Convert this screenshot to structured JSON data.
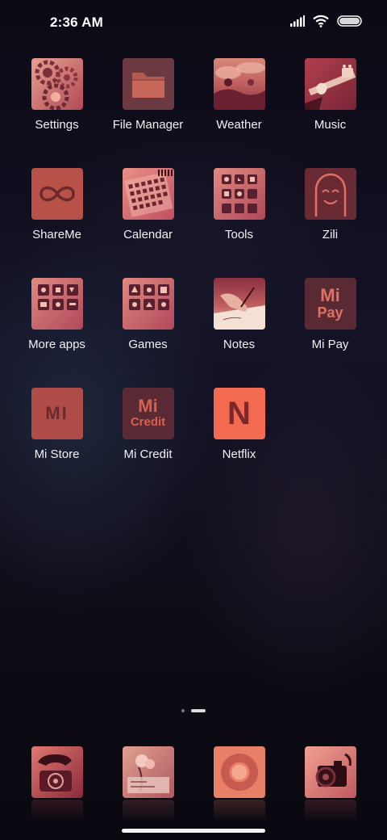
{
  "status_bar": {
    "time": "2:36 AM"
  },
  "apps": [
    {
      "label": "Settings",
      "icon": "settings-gears-icon"
    },
    {
      "label": "File Manager",
      "icon": "folder-icon"
    },
    {
      "label": "Weather",
      "icon": "weather-photo-icon"
    },
    {
      "label": "Music",
      "icon": "guitar-icon"
    },
    {
      "label": "ShareMe",
      "icon": "infinity-icon"
    },
    {
      "label": "Calendar",
      "icon": "calendar-grid-icon"
    },
    {
      "label": "Tools",
      "icon": "folder-grid-icon"
    },
    {
      "label": "Zili",
      "icon": "ghost-face-icon"
    },
    {
      "label": "More apps",
      "icon": "folder-grid-icon"
    },
    {
      "label": "Games",
      "icon": "folder-grid-icon"
    },
    {
      "label": "Notes",
      "icon": "writing-hand-icon"
    },
    {
      "label": "Mi Pay",
      "icon": "mi-pay-icon"
    },
    {
      "label": "Mi Store",
      "icon": "mi-logo-icon"
    },
    {
      "label": "Mi Credit",
      "icon": "mi-credit-icon"
    },
    {
      "label": "Netflix",
      "icon": "netflix-n-icon"
    }
  ],
  "icon_text": {
    "mi_pay": [
      "Mi",
      "Pay"
    ],
    "mi_credit": [
      "Mi",
      "Credit"
    ],
    "mi_store": "MI",
    "netflix": "N"
  },
  "dock": [
    {
      "icon": "phone-icon"
    },
    {
      "icon": "messages-icon"
    },
    {
      "icon": "browser-icon"
    },
    {
      "icon": "camera-icon"
    }
  ],
  "pages": {
    "count": 2,
    "current": 2
  },
  "colors": {
    "tint_light": "#e8836a",
    "tint_mid": "#c0504a",
    "tint_dark": "#7a3038",
    "netflix_bg": "#f26a50"
  }
}
